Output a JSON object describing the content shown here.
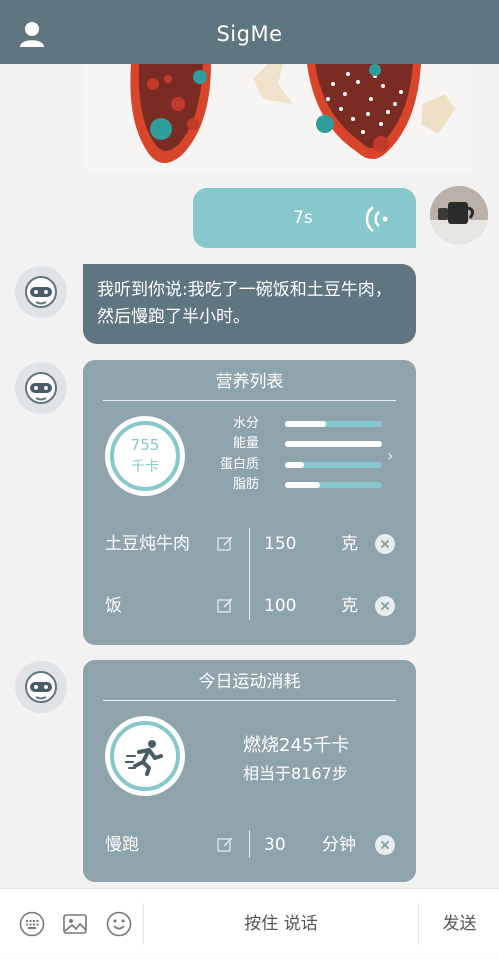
{
  "app": {
    "title": "SigMe"
  },
  "colors": {
    "header": "#5f7681",
    "accent": "#86c8cb",
    "card": "#8fa3ad"
  },
  "voice_message": {
    "duration": "7s"
  },
  "bot_message": {
    "text": "我听到你说:我吃了一碗饭和土豆牛肉，然后慢跑了半小时。"
  },
  "nutrition_card": {
    "title": "营养列表",
    "calories": "755",
    "calories_unit": "千卡",
    "nutrients": [
      {
        "label": "水分",
        "level": 0.42
      },
      {
        "label": "能量",
        "level": 1.0
      },
      {
        "label": "蛋白质",
        "level": 0.2
      },
      {
        "label": "脂肪",
        "level": 0.36
      }
    ],
    "items": [
      {
        "name": "土豆炖牛肉",
        "qty": "150",
        "unit": "克"
      },
      {
        "name": "饭",
        "qty": "100",
        "unit": "克"
      }
    ]
  },
  "exercise_card": {
    "title": "今日运动消耗",
    "burn": "燃烧245千卡",
    "equivalent": "相当于8167步",
    "items": [
      {
        "name": "慢跑",
        "qty": "30",
        "unit": "分钟"
      }
    ]
  },
  "bottom_bar": {
    "keyboard_icon": "keyboard-icon",
    "image_icon": "image-icon",
    "emoji_icon": "emoji-icon",
    "talk_label": "按住 说话",
    "send_label": "发送"
  }
}
